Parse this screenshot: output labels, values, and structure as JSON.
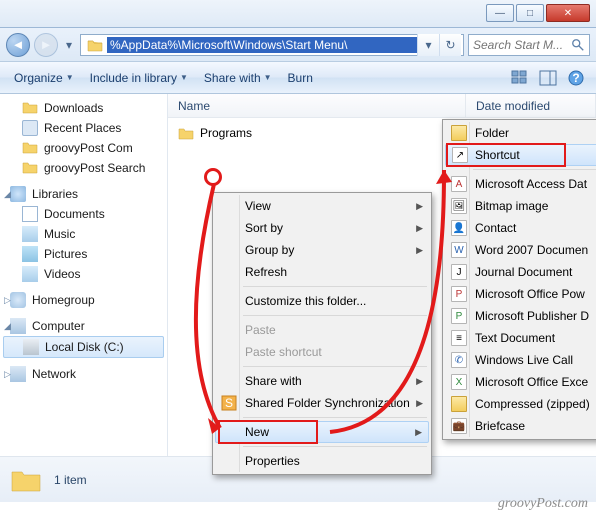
{
  "window": {
    "min": "—",
    "max": "□",
    "close": "✕"
  },
  "nav": {
    "back": "◄",
    "fwd": "►",
    "drop": "▾"
  },
  "address": {
    "value": "%AppData%\\Microsoft\\Windows\\Start Menu\\",
    "drop": "▾",
    "refresh": "↻"
  },
  "search": {
    "placeholder": "Search Start M..."
  },
  "toolbar": {
    "organize": "Organize",
    "include": "Include in library",
    "share": "Share with",
    "burn": "Burn",
    "tri": "▼"
  },
  "sidebar": {
    "downloads": "Downloads",
    "recent": "Recent Places",
    "gp_com": "groovyPost Com",
    "gp_search": "groovyPost Search",
    "libraries": "Libraries",
    "documents": "Documents",
    "music": "Music",
    "pictures": "Pictures",
    "videos": "Videos",
    "homegroup": "Homegroup",
    "computer": "Computer",
    "localdisk": "Local Disk (C:)",
    "network": "Network"
  },
  "columns": {
    "name": "Name",
    "date": "Date modified"
  },
  "files": {
    "programs": "Programs"
  },
  "context": {
    "view": "View",
    "sortby": "Sort by",
    "groupby": "Group by",
    "refresh": "Refresh",
    "customize": "Customize this folder...",
    "paste": "Paste",
    "paste_shortcut": "Paste shortcut",
    "sharewith": "Share with",
    "sfs": "Shared Folder Synchronization",
    "new": "New",
    "properties": "Properties"
  },
  "submenu": {
    "folder": "Folder",
    "shortcut": "Shortcut",
    "access": "Microsoft Access Dat",
    "bitmap": "Bitmap image",
    "contact": "Contact",
    "word": "Word 2007 Documen",
    "journal": "Journal Document",
    "ppt": "Microsoft Office Pow",
    "pub": "Microsoft Publisher D",
    "text": "Text Document",
    "wlc": "Windows Live Call",
    "excel": "Microsoft Office Exce",
    "zip": "Compressed (zipped)",
    "briefcase": "Briefcase"
  },
  "status": {
    "count": "1 item"
  },
  "watermark": "groovyPost.com"
}
